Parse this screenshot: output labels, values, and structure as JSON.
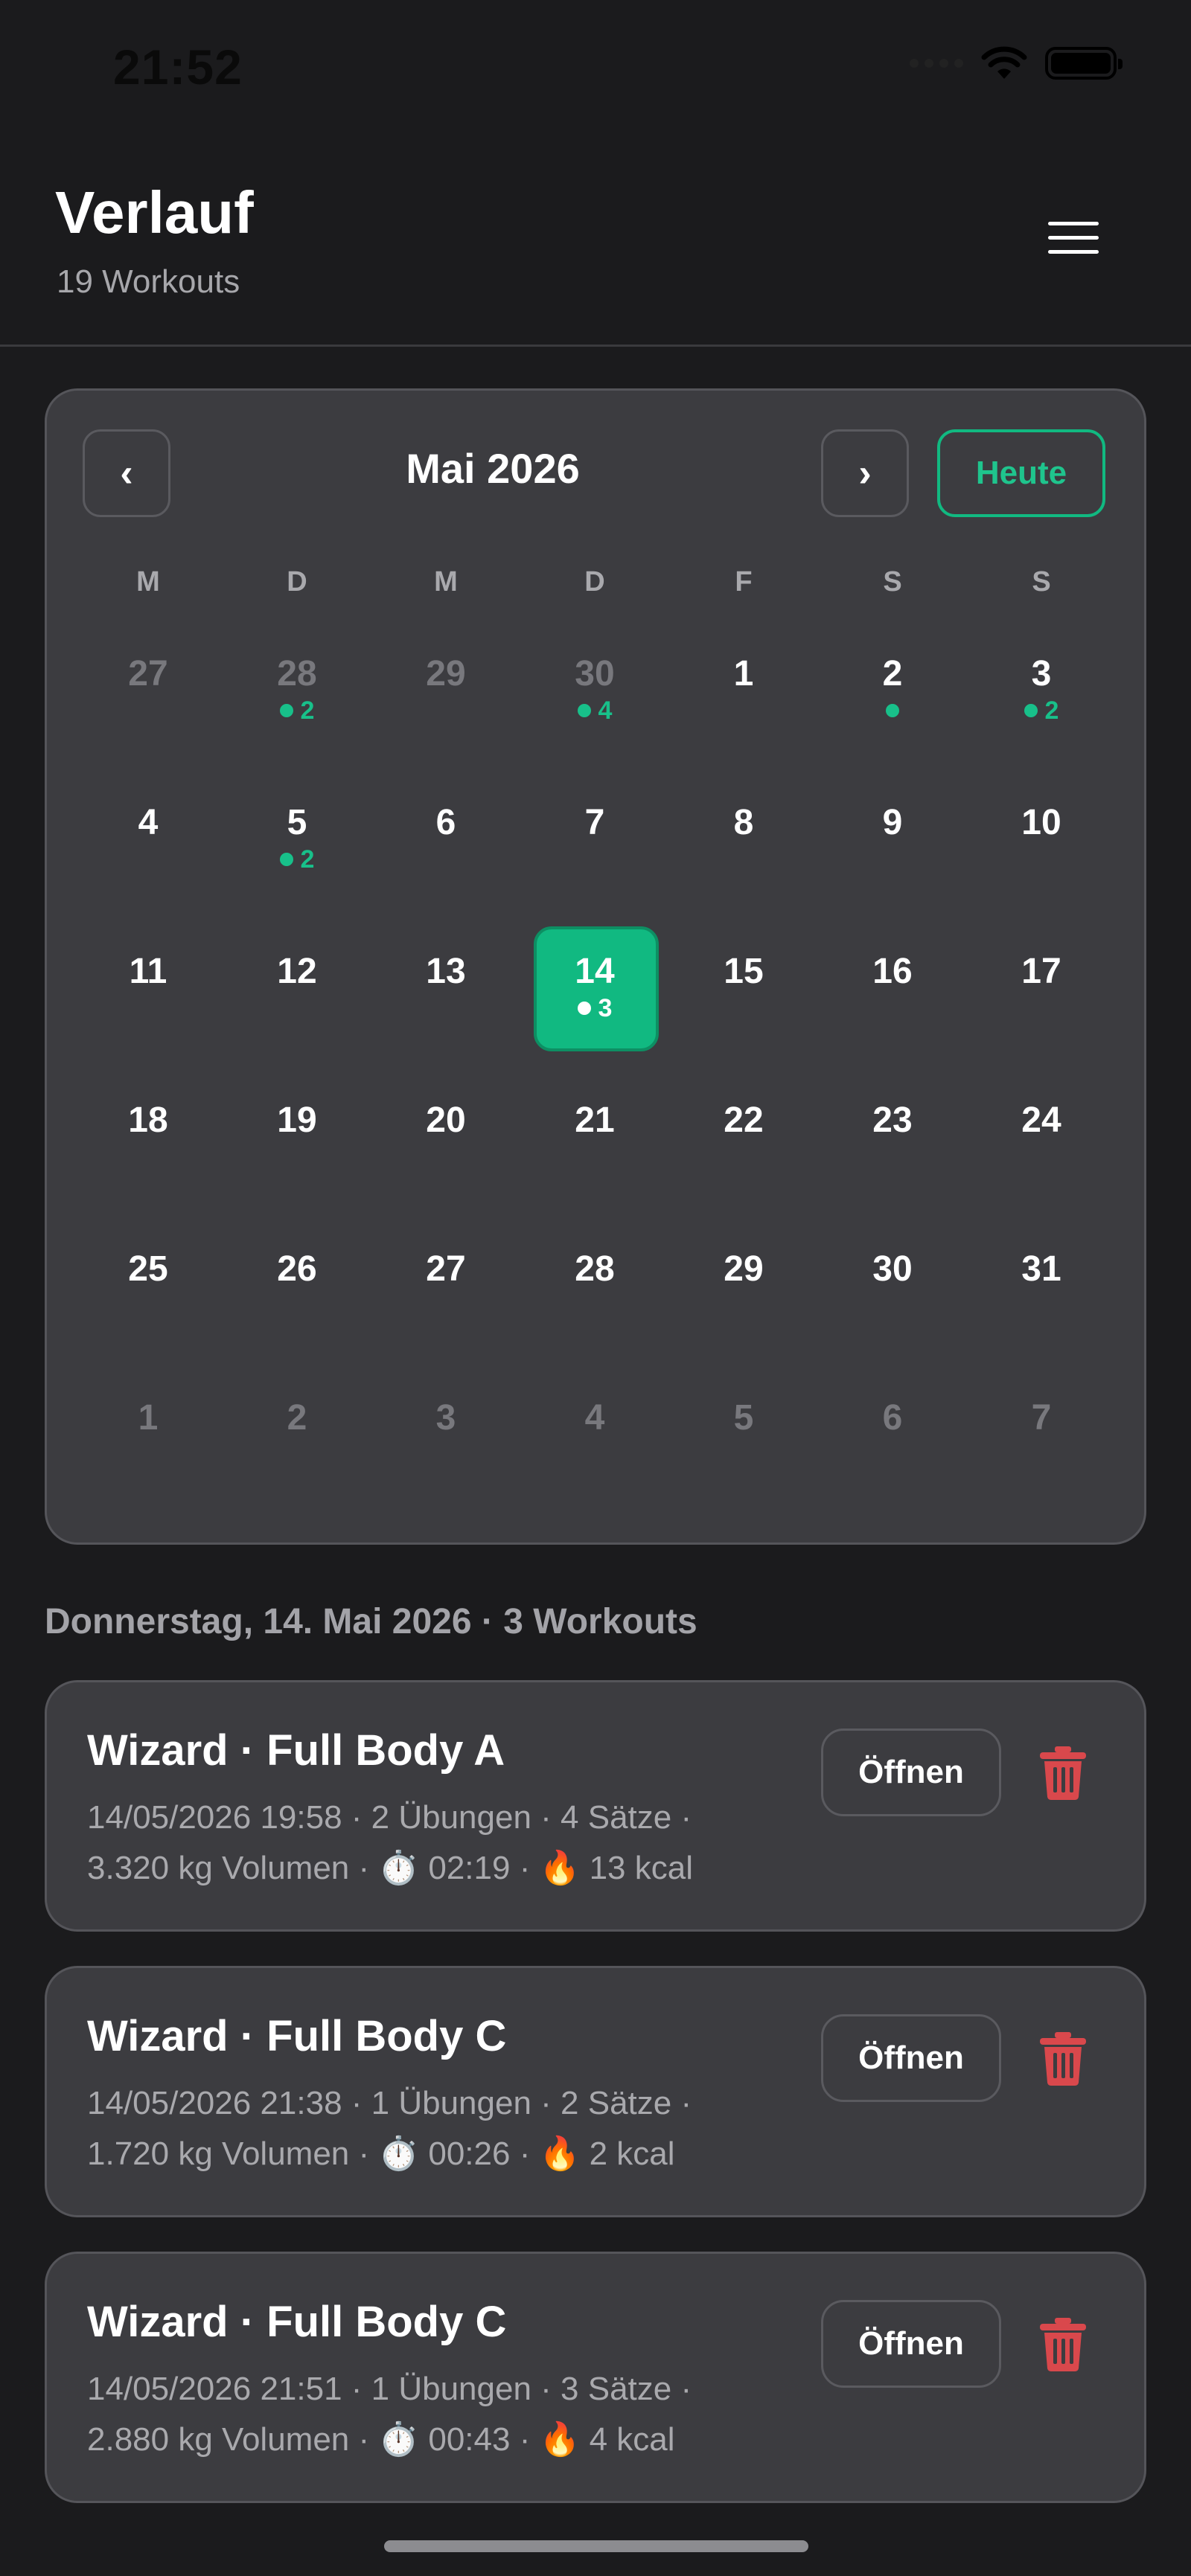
{
  "status_bar": {
    "time": "21:52"
  },
  "header": {
    "title": "Verlauf",
    "subtitle": "19 Workouts"
  },
  "calendar": {
    "month_label": "Mai 2026",
    "today_label": "Heute",
    "prev_label": "‹",
    "next_label": "›",
    "weekdays": [
      "M",
      "D",
      "M",
      "D",
      "F",
      "S",
      "S"
    ],
    "weeks": [
      [
        {
          "n": "27",
          "muted": true
        },
        {
          "n": "28",
          "muted": true,
          "c": "2"
        },
        {
          "n": "29",
          "muted": true
        },
        {
          "n": "30",
          "muted": true,
          "c": "4"
        },
        {
          "n": "1"
        },
        {
          "n": "2",
          "c": ""
        },
        {
          "n": "3",
          "c": "2"
        }
      ],
      [
        {
          "n": "4"
        },
        {
          "n": "5",
          "c": "2"
        },
        {
          "n": "6"
        },
        {
          "n": "7"
        },
        {
          "n": "8"
        },
        {
          "n": "9"
        },
        {
          "n": "10"
        }
      ],
      [
        {
          "n": "11"
        },
        {
          "n": "12"
        },
        {
          "n": "13"
        },
        {
          "n": "14",
          "c": "3",
          "selected": true
        },
        {
          "n": "15"
        },
        {
          "n": "16"
        },
        {
          "n": "17"
        }
      ],
      [
        {
          "n": "18"
        },
        {
          "n": "19"
        },
        {
          "n": "20"
        },
        {
          "n": "21"
        },
        {
          "n": "22"
        },
        {
          "n": "23"
        },
        {
          "n": "24"
        }
      ],
      [
        {
          "n": "25"
        },
        {
          "n": "26"
        },
        {
          "n": "27"
        },
        {
          "n": "28"
        },
        {
          "n": "29"
        },
        {
          "n": "30"
        },
        {
          "n": "31"
        }
      ],
      [
        {
          "n": "1",
          "muted": true
        },
        {
          "n": "2",
          "muted": true
        },
        {
          "n": "3",
          "muted": true
        },
        {
          "n": "4",
          "muted": true
        },
        {
          "n": "5",
          "muted": true
        },
        {
          "n": "6",
          "muted": true
        },
        {
          "n": "7",
          "muted": true
        }
      ]
    ]
  },
  "list_header": "Donnerstag, 14. Mai 2026 · 3 Workouts",
  "workouts": [
    {
      "title": "Wizard · Full Body A",
      "line1": "14/05/2026 19:58 · 2 Übungen · 4 Sätze ·",
      "line2": "3.320 kg Volumen · ⏱️ 02:19 · 🔥 13 kcal",
      "open_label": "Öffnen"
    },
    {
      "title": "Wizard · Full Body C",
      "line1": "14/05/2026 21:38 · 1 Übungen · 2 Sätze ·",
      "line2": "1.720 kg Volumen · ⏱️ 00:26 · 🔥 2 kcal",
      "open_label": "Öffnen"
    },
    {
      "title": "Wizard · Full Body C",
      "line1": "14/05/2026 21:51 · 1 Übungen · 3 Sätze ·",
      "line2": "2.880 kg Volumen · ⏱️ 00:43 · 🔥 4 kcal",
      "open_label": "Öffnen"
    }
  ],
  "colors": {
    "accent": "#11b981",
    "danger": "#d9484c",
    "background": "#1b1b1d",
    "card": "#3c3c40"
  },
  "icons": {
    "menu": "hamburger-icon",
    "delete": "trash-icon",
    "timer": "stopwatch-icon",
    "calories": "fire-icon",
    "wifi": "wifi-icon",
    "battery": "battery-icon"
  }
}
